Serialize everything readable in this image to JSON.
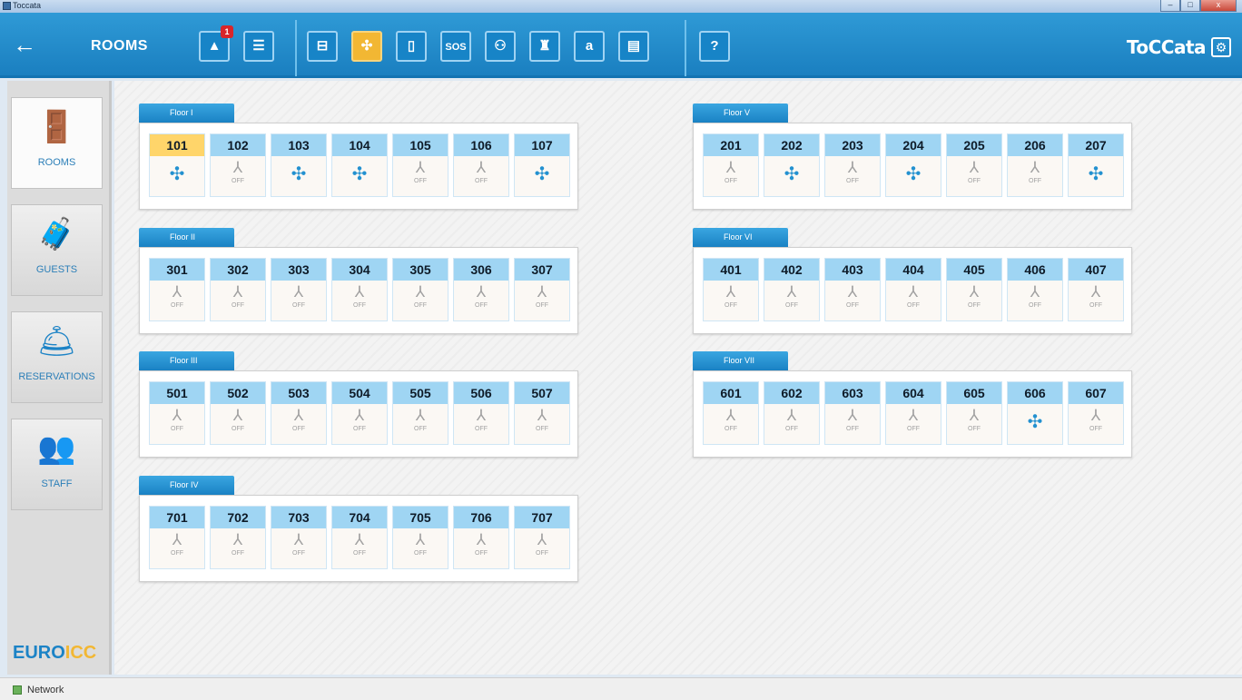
{
  "window": {
    "title": "Toccata",
    "controls": {
      "minimize": "–",
      "maximize": "□",
      "close": "x"
    }
  },
  "toolbar": {
    "back_icon": "←",
    "title": "ROOMS",
    "alert_count": "1",
    "buttons": [
      {
        "name": "alerts-button",
        "icon": "warning-icon",
        "glyph": "▲"
      },
      {
        "name": "list-button",
        "icon": "list-icon",
        "glyph": "☰"
      },
      {
        "name": "thermostat-button",
        "icon": "thermostat-icon",
        "glyph": "⊟"
      },
      {
        "name": "fan-button",
        "icon": "fan-icon",
        "glyph": "✣",
        "active": true
      },
      {
        "name": "door-button",
        "icon": "door-icon",
        "glyph": "▯"
      },
      {
        "name": "sos-button",
        "icon": "sos-icon",
        "glyph": "SOS"
      },
      {
        "name": "service-button",
        "icon": "service-icon",
        "glyph": "⚇"
      },
      {
        "name": "housekeeping-button",
        "icon": "housekeeping-icon",
        "glyph": "♜"
      },
      {
        "name": "do-not-disturb-button",
        "icon": "dnd-icon",
        "glyph": "a"
      },
      {
        "name": "card-button",
        "icon": "id-card-icon",
        "glyph": "▤"
      },
      {
        "name": "help-button",
        "icon": "help-icon",
        "glyph": "?"
      }
    ],
    "brand": "ToCCata",
    "settings_icon": "⚙"
  },
  "sidebar": {
    "items": [
      {
        "label": "ROOMS",
        "icon": "🚪",
        "active": true
      },
      {
        "label": "GUESTS",
        "icon": "🧳"
      },
      {
        "label": "RESERVATIONS",
        "icon": "🛎"
      },
      {
        "label": "STAFF",
        "icon": "👥"
      }
    ],
    "logo_euro": "EURO",
    "logo_icc": "ICC"
  },
  "floors": [
    {
      "label": "Floor I",
      "rooms": [
        {
          "num": "101",
          "state": "on",
          "selected": true
        },
        {
          "num": "102",
          "state": "off"
        },
        {
          "num": "103",
          "state": "on"
        },
        {
          "num": "104",
          "state": "on"
        },
        {
          "num": "105",
          "state": "off"
        },
        {
          "num": "106",
          "state": "off"
        },
        {
          "num": "107",
          "state": "on"
        }
      ]
    },
    {
      "label": "Floor V",
      "rooms": [
        {
          "num": "201",
          "state": "off"
        },
        {
          "num": "202",
          "state": "on"
        },
        {
          "num": "203",
          "state": "off"
        },
        {
          "num": "204",
          "state": "on"
        },
        {
          "num": "205",
          "state": "off"
        },
        {
          "num": "206",
          "state": "off"
        },
        {
          "num": "207",
          "state": "on"
        }
      ]
    },
    {
      "label": "Floor II",
      "rooms": [
        {
          "num": "301",
          "state": "off"
        },
        {
          "num": "302",
          "state": "off"
        },
        {
          "num": "303",
          "state": "off"
        },
        {
          "num": "304",
          "state": "off"
        },
        {
          "num": "305",
          "state": "off"
        },
        {
          "num": "306",
          "state": "off"
        },
        {
          "num": "307",
          "state": "off"
        }
      ]
    },
    {
      "label": "Floor VI",
      "rooms": [
        {
          "num": "401",
          "state": "off"
        },
        {
          "num": "402",
          "state": "off"
        },
        {
          "num": "403",
          "state": "off"
        },
        {
          "num": "404",
          "state": "off"
        },
        {
          "num": "405",
          "state": "off"
        },
        {
          "num": "406",
          "state": "off"
        },
        {
          "num": "407",
          "state": "off"
        }
      ]
    },
    {
      "label": "Floor III",
      "rooms": [
        {
          "num": "501",
          "state": "off"
        },
        {
          "num": "502",
          "state": "off"
        },
        {
          "num": "503",
          "state": "off"
        },
        {
          "num": "504",
          "state": "off"
        },
        {
          "num": "505",
          "state": "off"
        },
        {
          "num": "506",
          "state": "off"
        },
        {
          "num": "507",
          "state": "off"
        }
      ]
    },
    {
      "label": "Floor VII",
      "rooms": [
        {
          "num": "601",
          "state": "off"
        },
        {
          "num": "602",
          "state": "off"
        },
        {
          "num": "603",
          "state": "off"
        },
        {
          "num": "604",
          "state": "off"
        },
        {
          "num": "605",
          "state": "off"
        },
        {
          "num": "606",
          "state": "on"
        },
        {
          "num": "607",
          "state": "off"
        }
      ]
    },
    {
      "label": "Floor IV",
      "rooms": [
        {
          "num": "701",
          "state": "off"
        },
        {
          "num": "702",
          "state": "off"
        },
        {
          "num": "703",
          "state": "off"
        },
        {
          "num": "704",
          "state": "off"
        },
        {
          "num": "705",
          "state": "off"
        },
        {
          "num": "706",
          "state": "off"
        },
        {
          "num": "707",
          "state": "off"
        }
      ]
    }
  ],
  "off_label": "OFF",
  "fan_on_glyph": "✣",
  "fan_off_glyph": "⅄",
  "status": {
    "network_label": "Network"
  },
  "colors": {
    "accent": "#1a82c4",
    "selected": "#ffd56a",
    "room_header": "#9fd5f3",
    "fan_on": "#2391d0",
    "off": "#a1a1a1"
  }
}
